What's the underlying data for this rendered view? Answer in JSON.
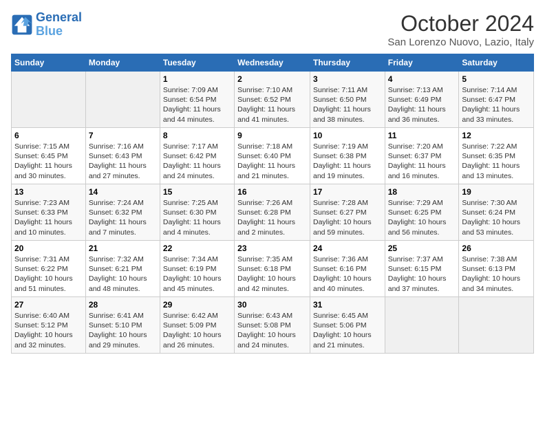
{
  "logo": {
    "line1": "General",
    "line2": "Blue"
  },
  "header": {
    "month": "October 2024",
    "location": "San Lorenzo Nuovo, Lazio, Italy"
  },
  "days_of_week": [
    "Sunday",
    "Monday",
    "Tuesday",
    "Wednesday",
    "Thursday",
    "Friday",
    "Saturday"
  ],
  "weeks": [
    [
      {
        "day": null,
        "content": ""
      },
      {
        "day": null,
        "content": ""
      },
      {
        "day": 1,
        "content": "Sunrise: 7:09 AM\nSunset: 6:54 PM\nDaylight: 11 hours and 44 minutes."
      },
      {
        "day": 2,
        "content": "Sunrise: 7:10 AM\nSunset: 6:52 PM\nDaylight: 11 hours and 41 minutes."
      },
      {
        "day": 3,
        "content": "Sunrise: 7:11 AM\nSunset: 6:50 PM\nDaylight: 11 hours and 38 minutes."
      },
      {
        "day": 4,
        "content": "Sunrise: 7:13 AM\nSunset: 6:49 PM\nDaylight: 11 hours and 36 minutes."
      },
      {
        "day": 5,
        "content": "Sunrise: 7:14 AM\nSunset: 6:47 PM\nDaylight: 11 hours and 33 minutes."
      }
    ],
    [
      {
        "day": 6,
        "content": "Sunrise: 7:15 AM\nSunset: 6:45 PM\nDaylight: 11 hours and 30 minutes."
      },
      {
        "day": 7,
        "content": "Sunrise: 7:16 AM\nSunset: 6:43 PM\nDaylight: 11 hours and 27 minutes."
      },
      {
        "day": 8,
        "content": "Sunrise: 7:17 AM\nSunset: 6:42 PM\nDaylight: 11 hours and 24 minutes."
      },
      {
        "day": 9,
        "content": "Sunrise: 7:18 AM\nSunset: 6:40 PM\nDaylight: 11 hours and 21 minutes."
      },
      {
        "day": 10,
        "content": "Sunrise: 7:19 AM\nSunset: 6:38 PM\nDaylight: 11 hours and 19 minutes."
      },
      {
        "day": 11,
        "content": "Sunrise: 7:20 AM\nSunset: 6:37 PM\nDaylight: 11 hours and 16 minutes."
      },
      {
        "day": 12,
        "content": "Sunrise: 7:22 AM\nSunset: 6:35 PM\nDaylight: 11 hours and 13 minutes."
      }
    ],
    [
      {
        "day": 13,
        "content": "Sunrise: 7:23 AM\nSunset: 6:33 PM\nDaylight: 11 hours and 10 minutes."
      },
      {
        "day": 14,
        "content": "Sunrise: 7:24 AM\nSunset: 6:32 PM\nDaylight: 11 hours and 7 minutes."
      },
      {
        "day": 15,
        "content": "Sunrise: 7:25 AM\nSunset: 6:30 PM\nDaylight: 11 hours and 4 minutes."
      },
      {
        "day": 16,
        "content": "Sunrise: 7:26 AM\nSunset: 6:28 PM\nDaylight: 11 hours and 2 minutes."
      },
      {
        "day": 17,
        "content": "Sunrise: 7:28 AM\nSunset: 6:27 PM\nDaylight: 10 hours and 59 minutes."
      },
      {
        "day": 18,
        "content": "Sunrise: 7:29 AM\nSunset: 6:25 PM\nDaylight: 10 hours and 56 minutes."
      },
      {
        "day": 19,
        "content": "Sunrise: 7:30 AM\nSunset: 6:24 PM\nDaylight: 10 hours and 53 minutes."
      }
    ],
    [
      {
        "day": 20,
        "content": "Sunrise: 7:31 AM\nSunset: 6:22 PM\nDaylight: 10 hours and 51 minutes."
      },
      {
        "day": 21,
        "content": "Sunrise: 7:32 AM\nSunset: 6:21 PM\nDaylight: 10 hours and 48 minutes."
      },
      {
        "day": 22,
        "content": "Sunrise: 7:34 AM\nSunset: 6:19 PM\nDaylight: 10 hours and 45 minutes."
      },
      {
        "day": 23,
        "content": "Sunrise: 7:35 AM\nSunset: 6:18 PM\nDaylight: 10 hours and 42 minutes."
      },
      {
        "day": 24,
        "content": "Sunrise: 7:36 AM\nSunset: 6:16 PM\nDaylight: 10 hours and 40 minutes."
      },
      {
        "day": 25,
        "content": "Sunrise: 7:37 AM\nSunset: 6:15 PM\nDaylight: 10 hours and 37 minutes."
      },
      {
        "day": 26,
        "content": "Sunrise: 7:38 AM\nSunset: 6:13 PM\nDaylight: 10 hours and 34 minutes."
      }
    ],
    [
      {
        "day": 27,
        "content": "Sunrise: 6:40 AM\nSunset: 5:12 PM\nDaylight: 10 hours and 32 minutes."
      },
      {
        "day": 28,
        "content": "Sunrise: 6:41 AM\nSunset: 5:10 PM\nDaylight: 10 hours and 29 minutes."
      },
      {
        "day": 29,
        "content": "Sunrise: 6:42 AM\nSunset: 5:09 PM\nDaylight: 10 hours and 26 minutes."
      },
      {
        "day": 30,
        "content": "Sunrise: 6:43 AM\nSunset: 5:08 PM\nDaylight: 10 hours and 24 minutes."
      },
      {
        "day": 31,
        "content": "Sunrise: 6:45 AM\nSunset: 5:06 PM\nDaylight: 10 hours and 21 minutes."
      },
      {
        "day": null,
        "content": ""
      },
      {
        "day": null,
        "content": ""
      }
    ]
  ]
}
